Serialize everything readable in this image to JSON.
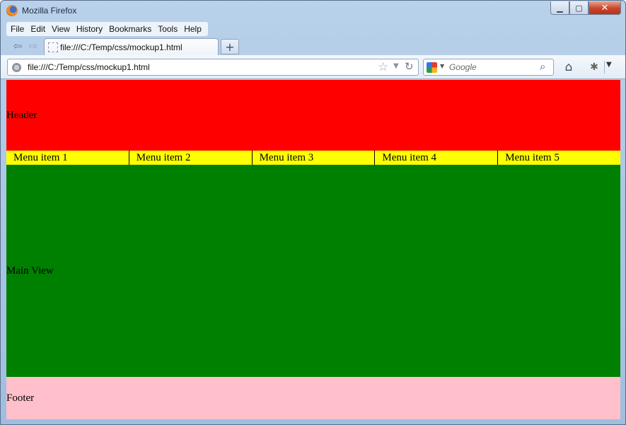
{
  "window": {
    "title": "Mozilla Firefox"
  },
  "menubar": {
    "items": [
      {
        "label": "File"
      },
      {
        "label": "Edit"
      },
      {
        "label": "View"
      },
      {
        "label": "History"
      },
      {
        "label": "Bookmarks"
      },
      {
        "label": "Tools"
      },
      {
        "label": "Help"
      }
    ]
  },
  "tab": {
    "label": "file:///C:/Temp/css/mockup1.html",
    "new_tab_symbol": "+"
  },
  "navbar": {
    "url": "file:///C:/Temp/css/mockup1.html",
    "search_placeholder": "Google"
  },
  "page": {
    "header": "Header",
    "menu": [
      "Menu item 1",
      "Menu item 2",
      "Menu item 3",
      "Menu item 4",
      "Menu item 5"
    ],
    "main": "Main View",
    "footer": "Footer"
  },
  "colors": {
    "header": "#ff0000",
    "menu": "#ffff00",
    "main": "#008000",
    "footer": "#ffc0cb"
  },
  "icons": [
    "firefox-logo",
    "back-arrow-icon",
    "forward-arrow-icon",
    "page-icon",
    "star-icon",
    "reload-icon",
    "google-icon",
    "search-icon",
    "home-icon",
    "bug-icon"
  ]
}
